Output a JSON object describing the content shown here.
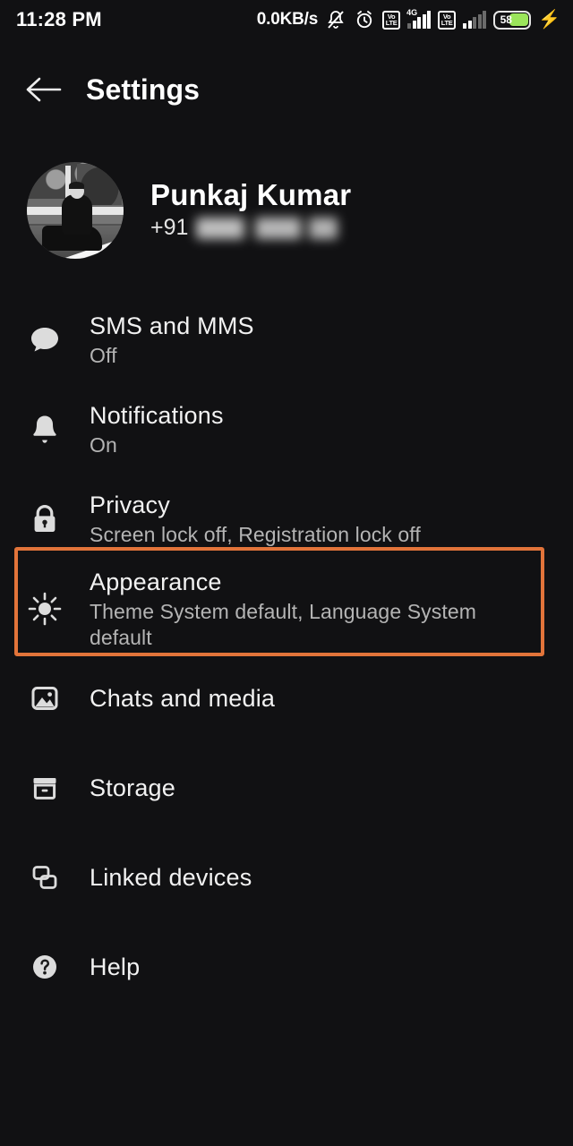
{
  "status_bar": {
    "clock": "11:28 PM",
    "network_speed": "0.0KB/s",
    "icons": [
      "bell-muted-icon",
      "alarm-clock-icon",
      "volte-badge-icon",
      "signal-bars-4g-icon",
      "volte-badge-icon",
      "signal-bars-icon"
    ],
    "volte_top_label": "Vo",
    "volte_bottom_label": "LTE",
    "network_generation_label": "4G",
    "battery_percent": "58",
    "battery_charging": true,
    "battery_fill_color": "#9BE55B"
  },
  "app_bar": {
    "back_icon": "arrow-left-icon",
    "title": "Settings"
  },
  "profile": {
    "name": "Punkaj Kumar",
    "phone_prefix": "+91",
    "phone_redacted": true,
    "avatar_alt": "profile-photo"
  },
  "highlight": {
    "target": "privacy",
    "border_color": "#E2743A"
  },
  "settings": {
    "items": [
      {
        "id": "sms-and-mms",
        "icon": "chat-bubble-icon",
        "title": "SMS and MMS",
        "subtitle": "Off"
      },
      {
        "id": "notifications",
        "icon": "bell-icon",
        "title": "Notifications",
        "subtitle": "On"
      },
      {
        "id": "privacy",
        "icon": "lock-icon",
        "title": "Privacy",
        "subtitle": "Screen lock off, Registration lock off"
      },
      {
        "id": "appearance",
        "icon": "brightness-sun-icon",
        "title": "Appearance",
        "subtitle": "Theme System default, Language System default"
      },
      {
        "id": "chats-and-media",
        "icon": "image-icon",
        "title": "Chats and media",
        "subtitle": ""
      },
      {
        "id": "storage",
        "icon": "archive-box-icon",
        "title": "Storage",
        "subtitle": ""
      },
      {
        "id": "linked-devices",
        "icon": "linked-devices-icon",
        "title": "Linked devices",
        "subtitle": ""
      },
      {
        "id": "help",
        "icon": "help-circle-icon",
        "title": "Help",
        "subtitle": ""
      }
    ]
  }
}
